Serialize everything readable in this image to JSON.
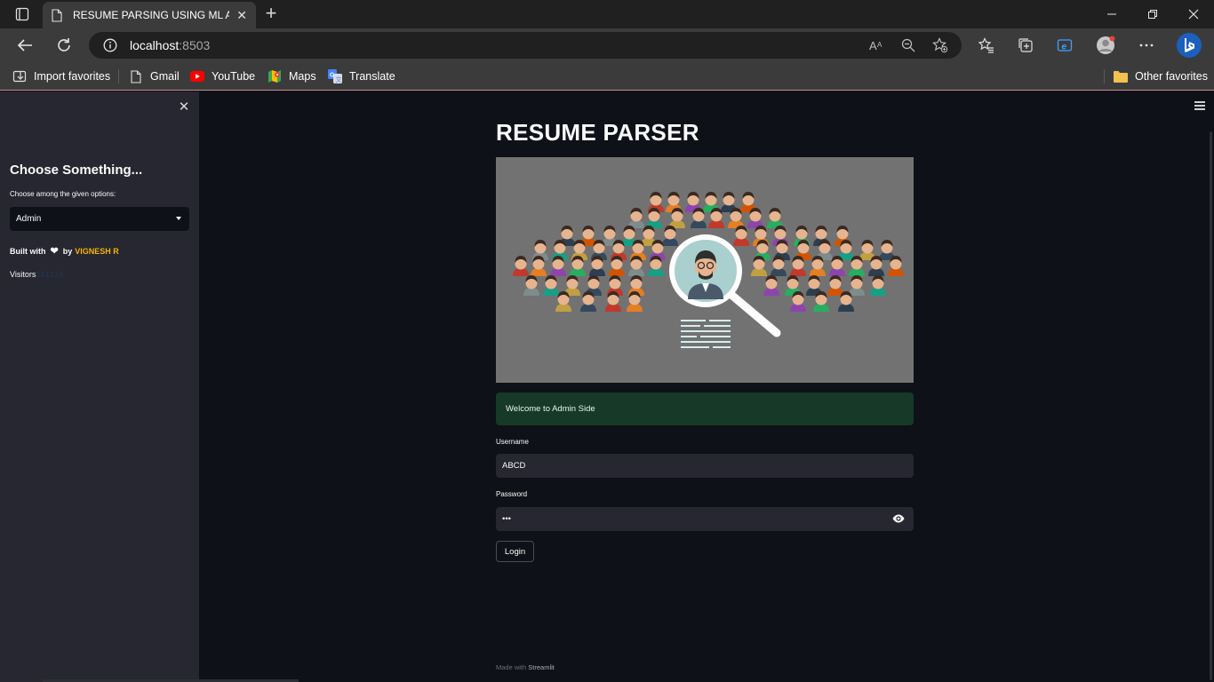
{
  "browser": {
    "tab_title": "RESUME PARSING USING ML AN",
    "url_host": "localhost",
    "url_port": ":8503",
    "favorites": [
      {
        "label": "Import favorites",
        "icon": "import-icon"
      },
      {
        "label": "Gmail",
        "icon": "page-icon"
      },
      {
        "label": "YouTube",
        "icon": "youtube-icon"
      },
      {
        "label": "Maps",
        "icon": "maps-icon"
      },
      {
        "label": "Translate",
        "icon": "translate-icon"
      }
    ],
    "other_favorites": "Other favorites"
  },
  "sidebar": {
    "heading": "Choose Something...",
    "select_label": "Choose among the given options:",
    "select_value": "Admin",
    "built_with": "Built with",
    "built_by": "by",
    "author": "VIGNESH R",
    "visitors_label": "Visitors",
    "visitors_count": "001128"
  },
  "main": {
    "title": "RESUME PARSER",
    "alert": "Welcome to Admin Side",
    "username_label": "Username",
    "username_value": "ABCD",
    "password_label": "Password",
    "password_value": "•••",
    "login_label": "Login",
    "footer_prefix": "Made with",
    "footer_brand": "Streamlit"
  },
  "colors": {
    "accent_author": "#f7b500",
    "success_bg": "#173928",
    "app_bg": "#0e1117",
    "sidebar_bg": "#262730"
  }
}
